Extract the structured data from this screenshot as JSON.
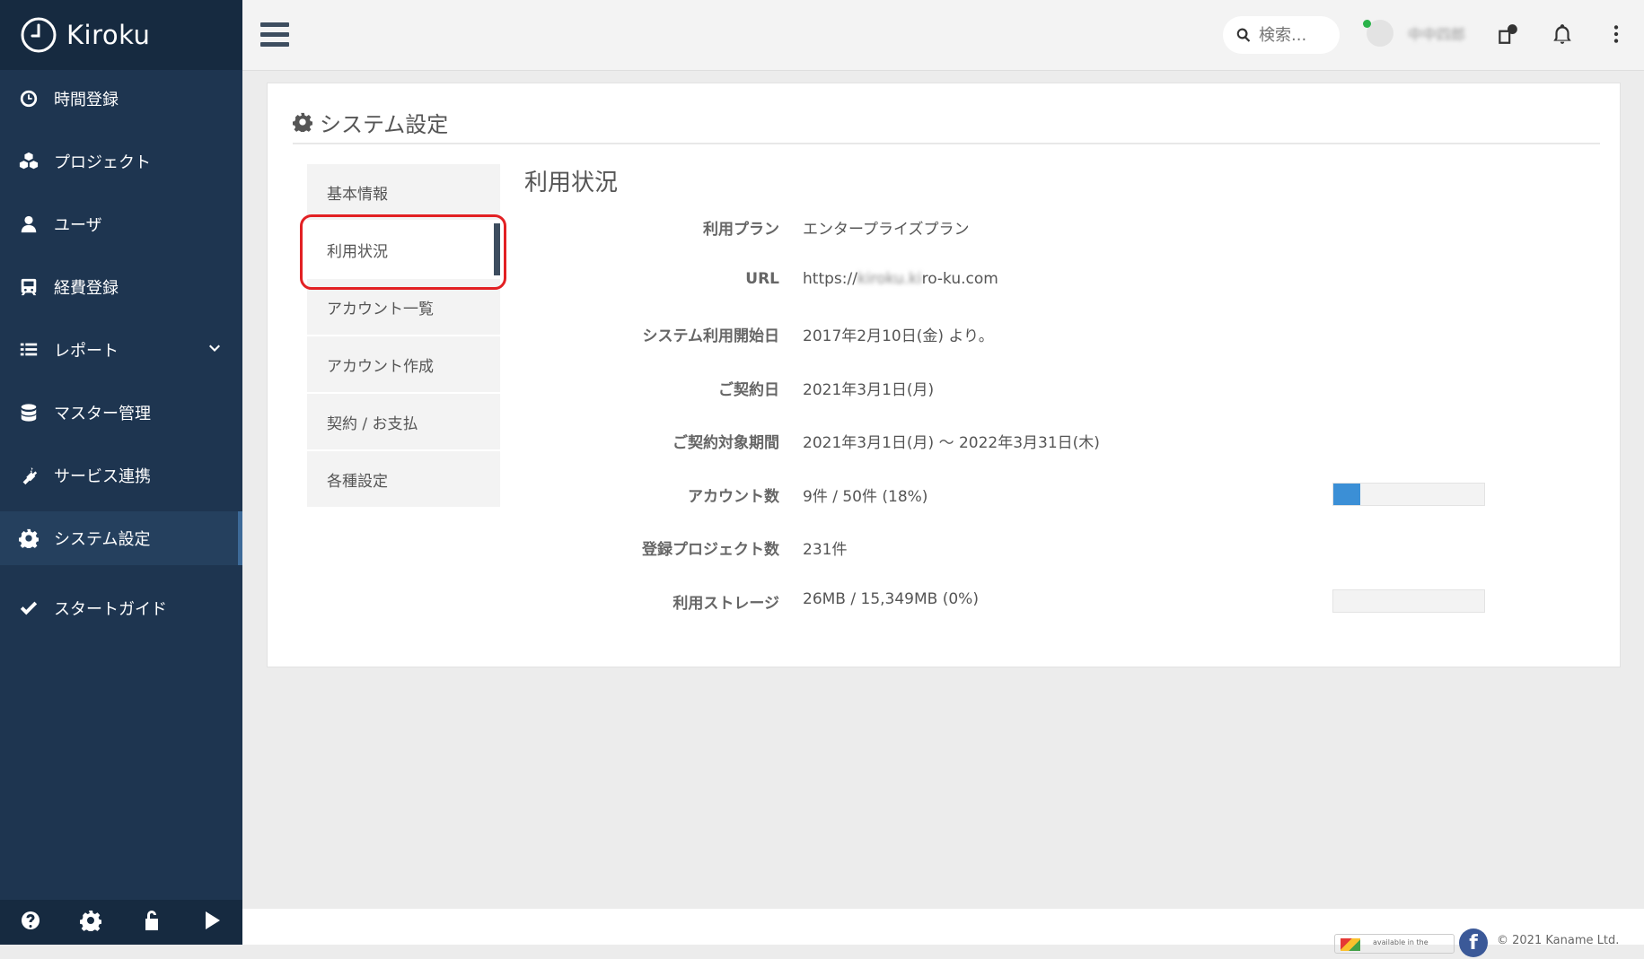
{
  "app": {
    "name": "Kiroku"
  },
  "sidebar": {
    "items": [
      {
        "label": "時間登録",
        "icon": "clock-icon"
      },
      {
        "label": "プロジェクト",
        "icon": "cubes-icon"
      },
      {
        "label": "ユーザ",
        "icon": "user-icon"
      },
      {
        "label": "経費登録",
        "icon": "train-icon"
      },
      {
        "label": "レポート",
        "icon": "list-icon"
      },
      {
        "label": "マスター管理",
        "icon": "database-icon"
      },
      {
        "label": "サービス連携",
        "icon": "plug-icon"
      },
      {
        "label": "システム設定",
        "icon": "gear-icon",
        "active": true
      },
      {
        "label": "スタートガイド",
        "icon": "check-icon"
      }
    ]
  },
  "topbar": {
    "search_placeholder": "検索...",
    "user_name": "中中四郎"
  },
  "page": {
    "title": "システム設定",
    "subnav": [
      {
        "label": "基本情報"
      },
      {
        "label": "利用状況",
        "active": true
      },
      {
        "label": "アカウント一覧"
      },
      {
        "label": "アカウント作成"
      },
      {
        "label": "契約 / お支払"
      },
      {
        "label": "各種設定"
      }
    ],
    "content_title": "利用状況",
    "rows": {
      "plan": {
        "label": "利用プラン",
        "value": "エンタープライズプラン"
      },
      "url": {
        "label": "URL",
        "prefix": "https://",
        "blurred": "kiroku.ki",
        "suffix": "ro-ku.com"
      },
      "start": {
        "label": "システム利用開始日",
        "value": "2017年2月10日(金) より。"
      },
      "contract": {
        "label": "ご契約日",
        "value": "2021年3月1日(月)"
      },
      "period": {
        "label": "ご契約対象期間",
        "value": "2021年3月1日(月) ～ 2022年3月31日(木)"
      },
      "accounts": {
        "label": "アカウント数",
        "value": "9件 / 50件 (18%)",
        "usage_percent": 18
      },
      "projects": {
        "label": "登録プロジェクト数",
        "value": "231件"
      },
      "storage": {
        "label": "利用ストレージ",
        "value": "26MB / 15,349MB (0%)",
        "usage_percent": 0
      }
    }
  },
  "footer": {
    "badge_text": "available in the",
    "copyright": "© 2021 Kaname Ltd."
  },
  "colors": {
    "sidebar_bg": "#1e3550",
    "highlight": "#e22023",
    "progress_fill": "#3b8fd6"
  }
}
